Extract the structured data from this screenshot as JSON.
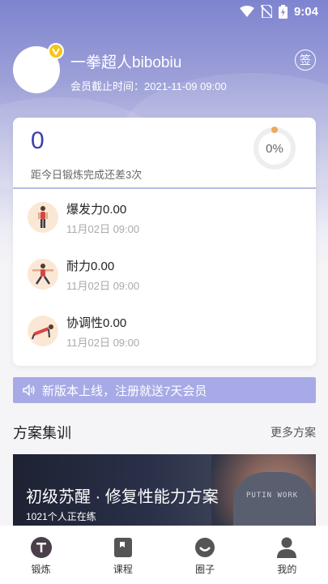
{
  "status_bar": {
    "time": "9:04"
  },
  "profile": {
    "username": "一拳超人bibobiu",
    "expire_text": "会员截止时间：2021-11-09 09:00",
    "sign_label": "签"
  },
  "progress": {
    "count": "0",
    "remaining_text": "距今日锻炼完成还差3次",
    "percent_text": "0%",
    "percent_value": 0
  },
  "items": [
    {
      "title": "爆发力0.00",
      "time": "11月02日 09:00",
      "icon": "burst-power-figure-icon"
    },
    {
      "title": "耐力0.00",
      "time": "11月02日 09:00",
      "icon": "endurance-figure-icon"
    },
    {
      "title": "协调性0.00",
      "time": "11月02日 09:00",
      "icon": "coordination-figure-icon"
    }
  ],
  "notice": {
    "text": "新版本上线，注册就送7天会员",
    "icon": "speaker-icon"
  },
  "section": {
    "title": "方案集训",
    "more_label": "更多方案"
  },
  "banner": {
    "title": "初级苏醒 · 修复性能力方案",
    "subtitle": "1021个人正在练",
    "shirt_text": "PUTIN WORK"
  },
  "tabs": [
    {
      "label": "锻炼",
      "icon": "training-icon",
      "active": true
    },
    {
      "label": "课程",
      "icon": "course-icon",
      "active": false
    },
    {
      "label": "圈子",
      "icon": "circle-icon",
      "active": false
    },
    {
      "label": "我的",
      "icon": "profile-icon",
      "active": false
    }
  ],
  "colors": {
    "accent": "#3a3fb0",
    "header": "#7e84cf",
    "notice": "#a7aae6",
    "vip": "#f5c518",
    "ring_dot": "#f0a85a"
  }
}
